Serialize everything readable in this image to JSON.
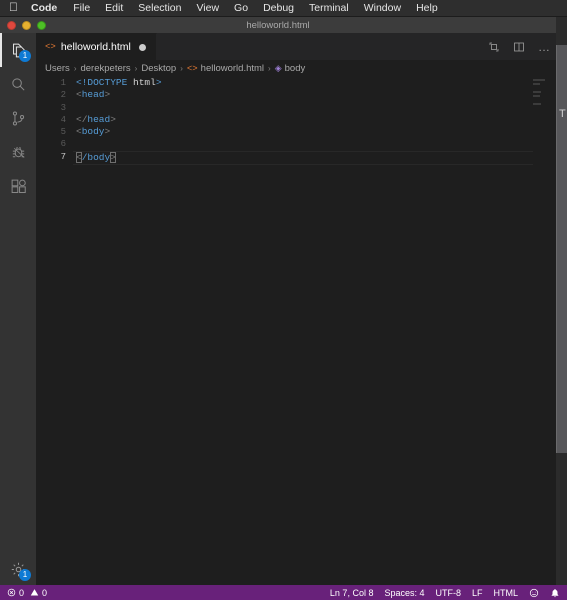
{
  "menubar": {
    "apple_icon": "apple-icon",
    "items": [
      {
        "label": "Code",
        "bold": true
      },
      {
        "label": "File",
        "bold": false
      },
      {
        "label": "Edit",
        "bold": false
      },
      {
        "label": "Selection",
        "bold": false
      },
      {
        "label": "View",
        "bold": false
      },
      {
        "label": "Go",
        "bold": false
      },
      {
        "label": "Debug",
        "bold": false
      },
      {
        "label": "Terminal",
        "bold": false
      },
      {
        "label": "Window",
        "bold": false
      },
      {
        "label": "Help",
        "bold": false
      }
    ]
  },
  "window": {
    "title": "helloworld.html",
    "traffic_lights": [
      "close-button",
      "minimize-button",
      "zoom-button"
    ]
  },
  "background_window": {
    "visible_letter": "T"
  },
  "activitybar": {
    "items": [
      {
        "name": "explorer",
        "icon": "files-icon",
        "badge": "1",
        "active": true
      },
      {
        "name": "search",
        "icon": "search-icon",
        "badge": "",
        "active": false
      },
      {
        "name": "source-control",
        "icon": "source-control-icon",
        "badge": "",
        "active": false
      },
      {
        "name": "run-and-debug",
        "icon": "debug-icon",
        "badge": "",
        "active": false
      },
      {
        "name": "extensions",
        "icon": "extensions-icon",
        "badge": "",
        "active": false
      }
    ],
    "bottom": [
      {
        "name": "manage-settings",
        "icon": "gear-icon",
        "badge": "1"
      }
    ]
  },
  "editor": {
    "tab": {
      "label": "helloworld.html",
      "file_icon": "html-file-icon",
      "dirty": true
    },
    "actions": [
      {
        "name": "open-preview",
        "icon": "open-preview-icon"
      },
      {
        "name": "split-editor",
        "icon": "split-editor-icon"
      },
      {
        "name": "more-actions",
        "icon": "ellipsis-icon",
        "glyph": "…"
      }
    ],
    "breadcrumbs": [
      {
        "label": "Users",
        "icon": ""
      },
      {
        "label": "derekpeters",
        "icon": ""
      },
      {
        "label": "Desktop",
        "icon": ""
      },
      {
        "label": "helloworld.html",
        "icon": "html-file-icon"
      },
      {
        "label": "body",
        "icon": "symbol-field-icon"
      }
    ],
    "separator": "›",
    "lines": [
      {
        "n": "1",
        "tokens": [
          {
            "t": "<!DOCTYPE ",
            "c": "t-meta"
          },
          {
            "t": "html",
            "c": "t-txt"
          },
          {
            "t": ">",
            "c": "t-meta"
          }
        ]
      },
      {
        "n": "2",
        "tokens": [
          {
            "t": "<",
            "c": "t-punct"
          },
          {
            "t": "head",
            "c": "t-tag"
          },
          {
            "t": ">",
            "c": "t-punct"
          }
        ]
      },
      {
        "n": "3",
        "tokens": []
      },
      {
        "n": "4",
        "tokens": [
          {
            "t": "</",
            "c": "t-punct"
          },
          {
            "t": "head",
            "c": "t-tag"
          },
          {
            "t": ">",
            "c": "t-punct"
          }
        ]
      },
      {
        "n": "5",
        "tokens": [
          {
            "t": "<",
            "c": "t-punct"
          },
          {
            "t": "body",
            "c": "t-tag"
          },
          {
            "t": ">",
            "c": "t-punct"
          }
        ]
      },
      {
        "n": "6",
        "tokens": []
      },
      {
        "n": "7",
        "tokens": [
          {
            "t": "<",
            "c": "bracket-match"
          },
          {
            "t": "/body",
            "c": "t-tag"
          },
          {
            "t": ">",
            "c": "bracket-match"
          }
        ],
        "current": true,
        "caret": true
      }
    ],
    "current_line": "7"
  },
  "statusbar": {
    "problems": {
      "error_icon": "error-icon",
      "error_count": "0",
      "warning_icon": "warning-icon",
      "warning_count": "0"
    },
    "right_items": [
      {
        "name": "cursor-position",
        "label": "Ln 7, Col 8"
      },
      {
        "name": "indentation",
        "label": "Spaces: 4"
      },
      {
        "name": "encoding",
        "label": "UTF-8"
      },
      {
        "name": "eol",
        "label": "LF"
      },
      {
        "name": "language-mode",
        "label": "HTML"
      }
    ],
    "feedback_icon": "smiley-icon",
    "notifications_icon": "bell-icon",
    "background_color": "#68217a"
  }
}
